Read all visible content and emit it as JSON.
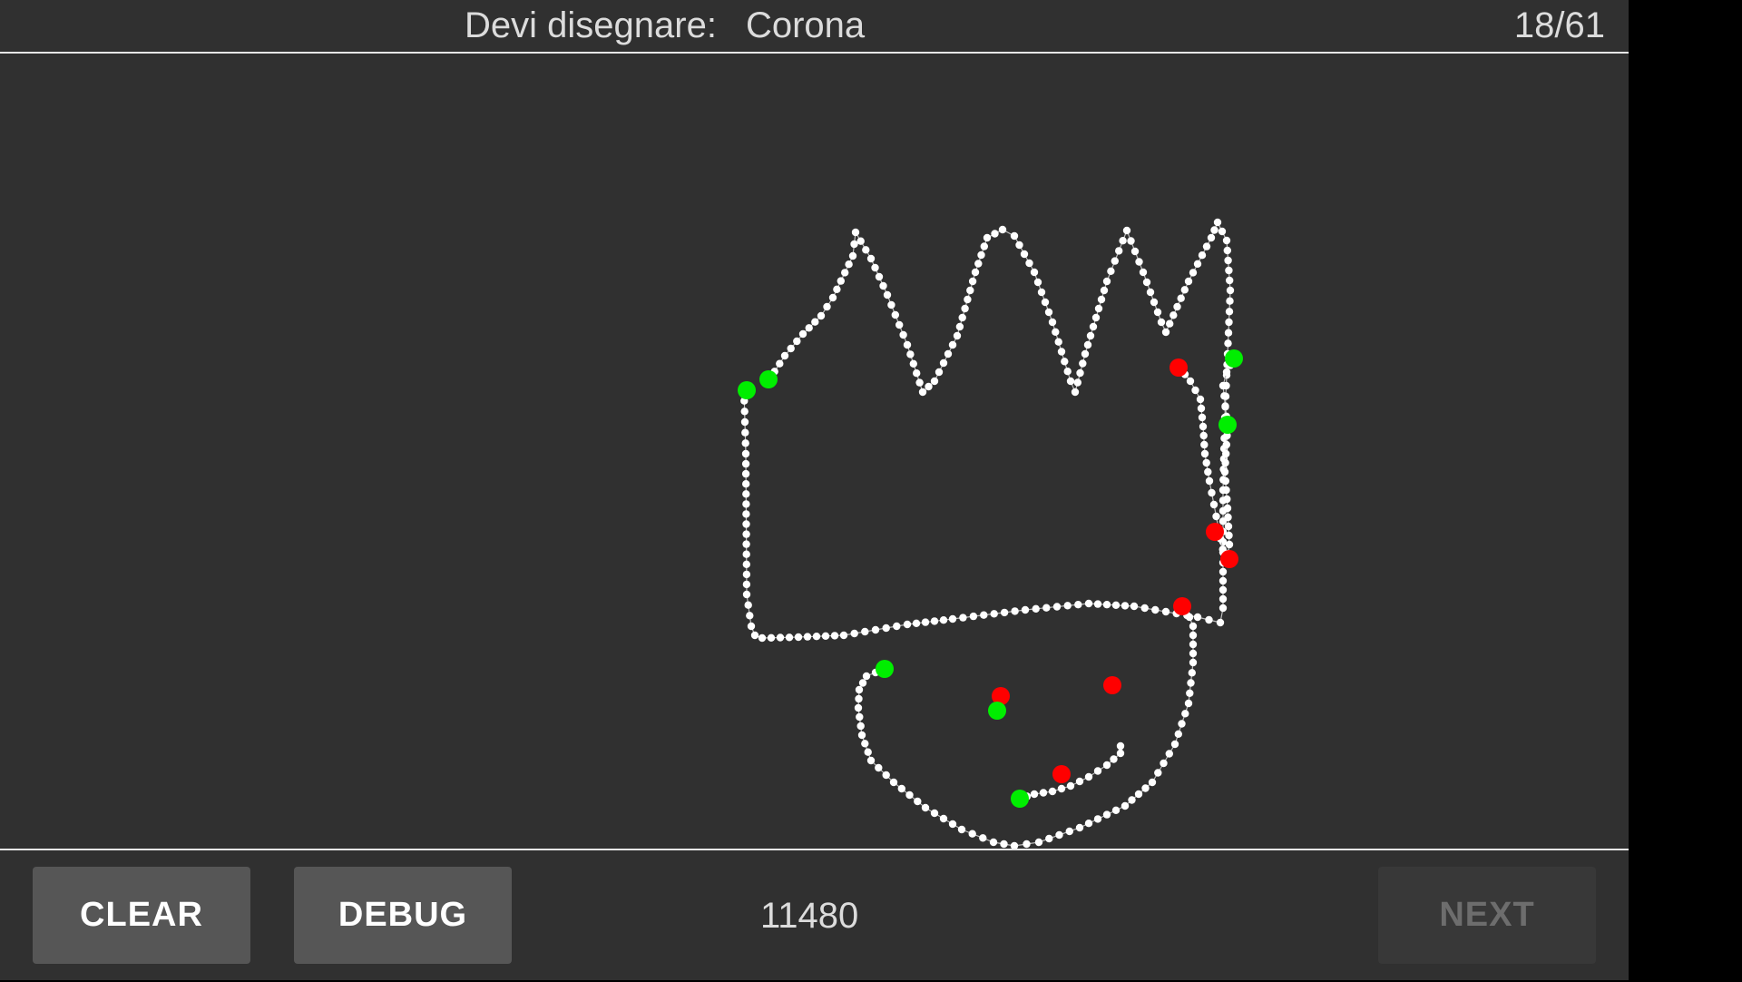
{
  "header": {
    "prompt_label": "Devi disegnare:",
    "prompt_word": "Corona",
    "progress": "18/61"
  },
  "footer": {
    "clear_label": "CLEAR",
    "debug_label": "DEBUG",
    "score": "11480",
    "next_label": "NEXT"
  },
  "colors": {
    "background": "#303030",
    "stroke_point": "#ffffff",
    "stroke_start": "#00ee00",
    "stroke_end": "#ff0000"
  }
}
